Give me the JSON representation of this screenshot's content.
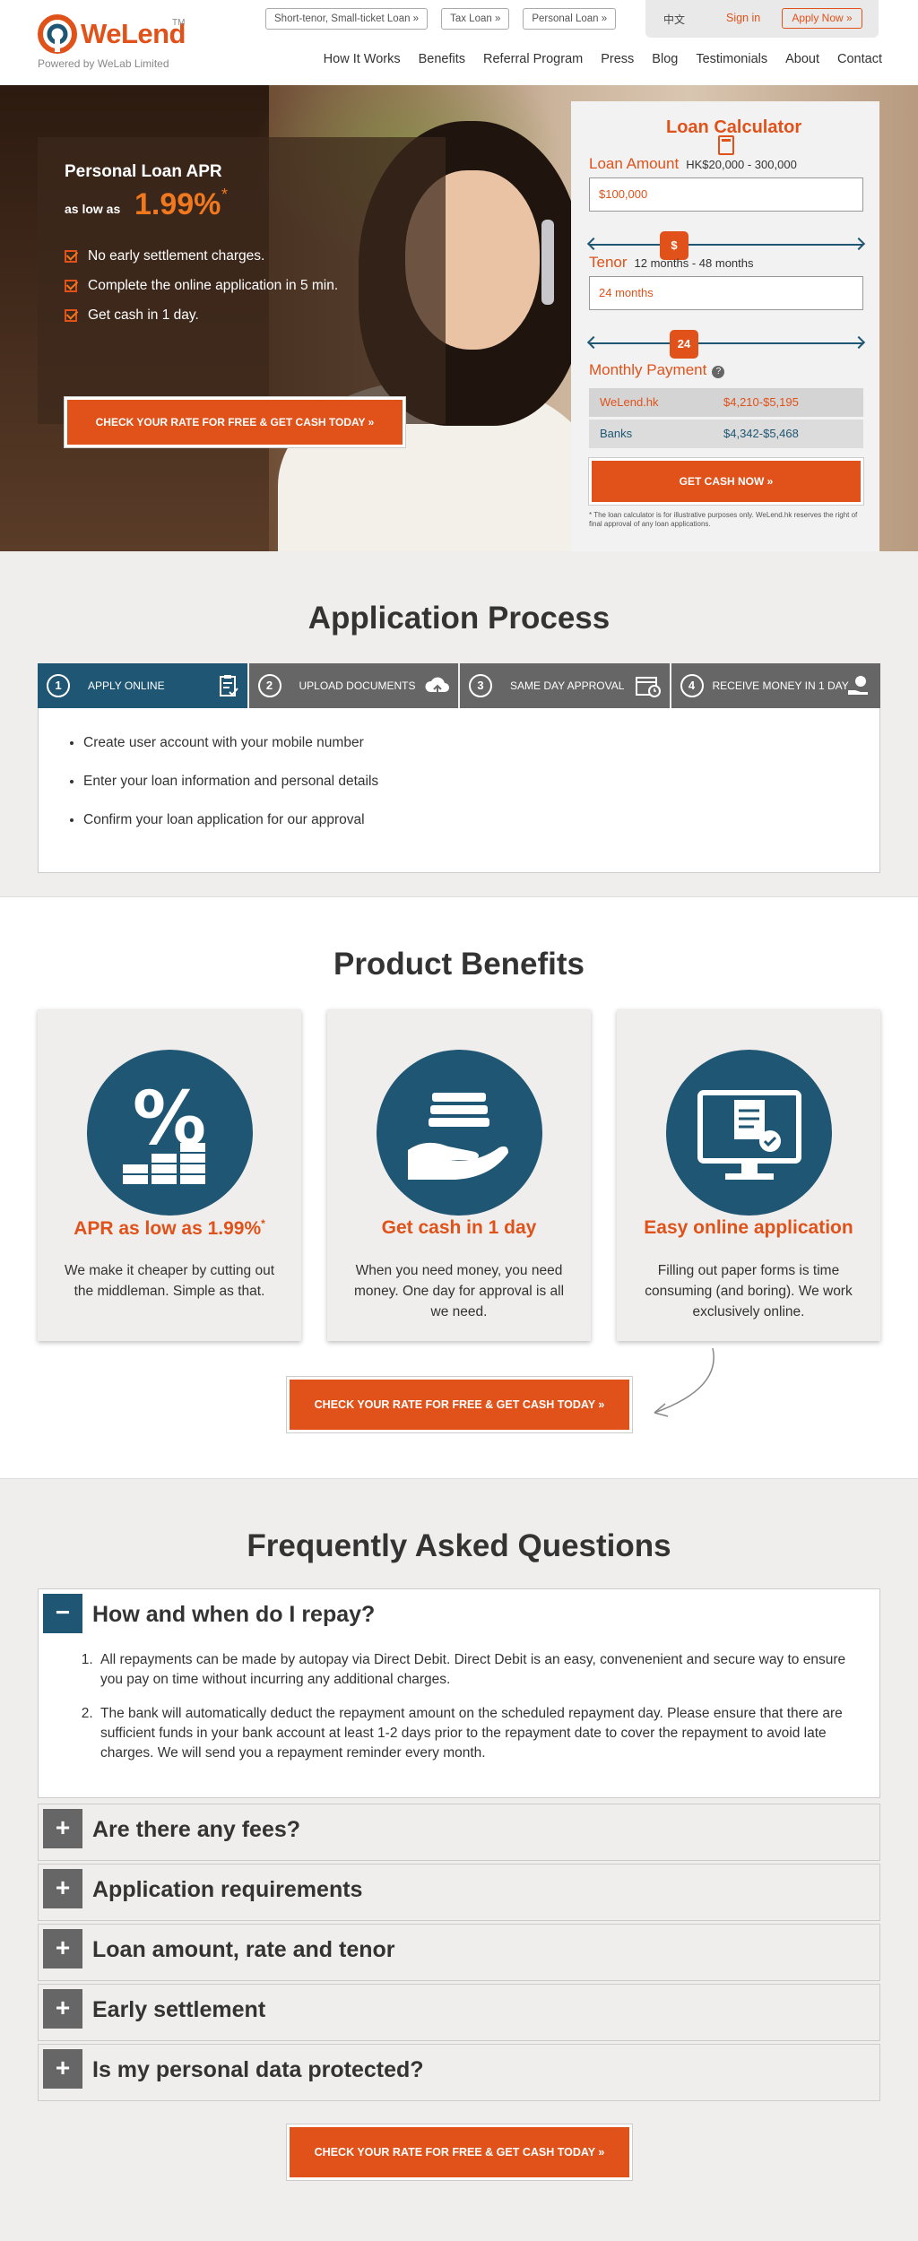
{
  "brand": {
    "name": "WeLend",
    "tm": "TM",
    "tagline": "Powered by WeLab Limited"
  },
  "header": {
    "top_links": [
      "Short-tenor, Small-ticket Loan »",
      "Tax Loan »",
      "Personal Loan »"
    ],
    "lang": "中文",
    "signin": "Sign in",
    "apply": "Apply Now »",
    "nav": [
      "How It Works",
      "Benefits",
      "Referral Program",
      "Press",
      "Blog",
      "Testimonials",
      "About",
      "Contact"
    ]
  },
  "hero": {
    "title": "Personal Loan APR",
    "as_low_as": "as low as",
    "rate": "1.99%",
    "star": "*",
    "bullets": [
      "No early settlement charges.",
      "Complete the online application in 5 min.",
      "Get cash in 1 day."
    ],
    "cta": "CHECK YOUR RATE FOR FREE & GET CASH TODAY »"
  },
  "calculator": {
    "title": "Loan Calculator",
    "amount_label": "Loan Amount",
    "amount_hint": "HK$20,000 - 300,000",
    "amount_value": "$100,000",
    "amount_handle": "$",
    "amount_slider_fraction": 0.29,
    "tenor_label": "Tenor",
    "tenor_hint": "12 months - 48 months",
    "tenor_value": "24 months",
    "tenor_handle": "24",
    "tenor_slider_fraction": 0.33,
    "payment_label": "Monthly Payment",
    "help": "?",
    "rows": [
      {
        "name": "WeLend.hk",
        "value": "$4,210-$5,195"
      },
      {
        "name": "Banks",
        "value": "$4,342-$5,468"
      }
    ],
    "cta": "GET CASH NOW »",
    "note": "* The loan calculator is for illustrative purposes only. WeLend.hk reserves the right of final approval of any loan applications."
  },
  "process": {
    "title": "Application Process",
    "steps": [
      {
        "num": "1",
        "label": "APPLY ONLINE"
      },
      {
        "num": "2",
        "label": "UPLOAD DOCUMENTS"
      },
      {
        "num": "3",
        "label": "SAME DAY APPROVAL"
      },
      {
        "num": "4",
        "label": "RECEIVE MONEY IN 1 DAY"
      }
    ],
    "items": [
      "Create user account with your mobile number",
      "Enter your loan information and personal details",
      "Confirm your loan application for our approval"
    ]
  },
  "benefits": {
    "title": "Product Benefits",
    "cards": [
      {
        "title": "APR as low as 1.99%",
        "star": "*",
        "text": "We make it cheaper by cutting out the middleman. Simple as that."
      },
      {
        "title": "Get cash in 1 day",
        "star": "",
        "text": "When you need money, you need money. One day for approval is all we need."
      },
      {
        "title": "Easy online application",
        "star": "",
        "text": "Filling out paper forms is time consuming (and boring). We work exclusively online."
      }
    ],
    "cta": "CHECK YOUR RATE FOR FREE & GET CASH TODAY »"
  },
  "faq": {
    "title": "Frequently Asked Questions",
    "open": {
      "toggle": "−",
      "question": "How and when do I repay?",
      "answers": [
        "All repayments can be made by autopay via Direct Debit. Direct Debit is an easy, convenenient and secure way to ensure you pay on time without incurring any additional charges.",
        "The bank will automatically deduct the repayment amount on the scheduled repayment day. Please ensure that there are sufficient funds in your bank account at least 1-2 days prior to the repayment date to cover the repayment to avoid late charges. We will send you a repayment reminder every month."
      ]
    },
    "closed_toggle": "+",
    "closed": [
      "Are there any fees?",
      "Application requirements",
      "Loan amount, rate and tenor",
      "Early settlement",
      "Is my personal data protected?"
    ],
    "cta": "CHECK YOUR RATE FOR FREE & GET CASH TODAY »"
  },
  "colors": {
    "accent": "#e0521a",
    "primary": "#1e5673",
    "neutral": "#666666",
    "section_bg": "#efeeec"
  }
}
